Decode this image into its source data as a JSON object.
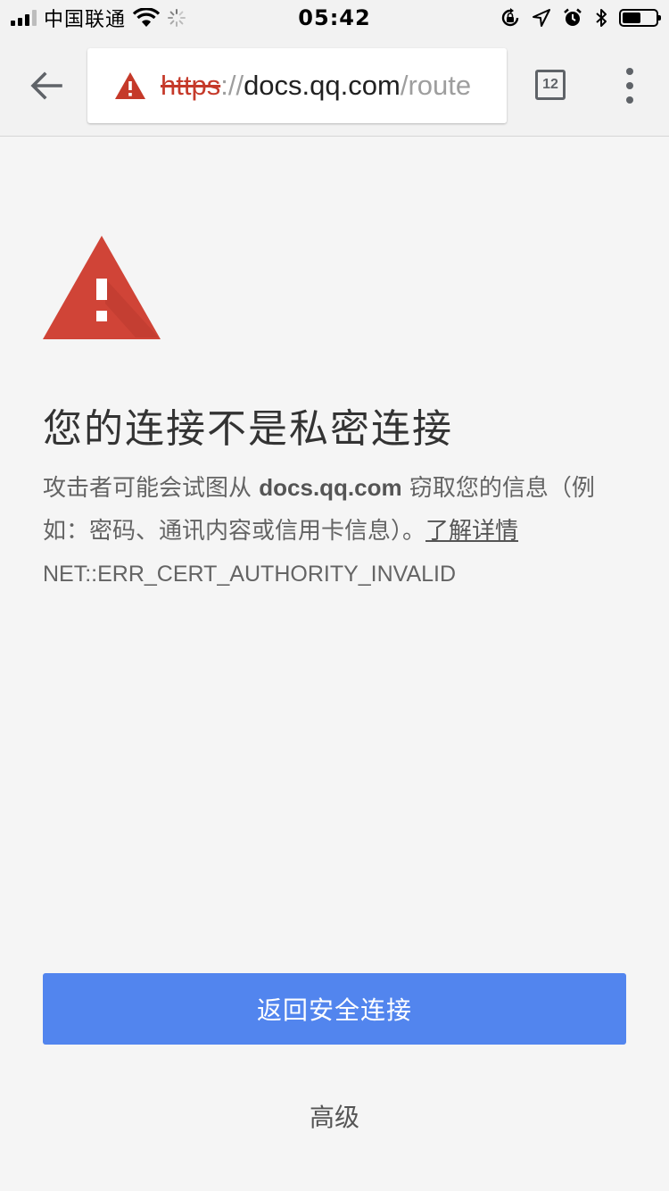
{
  "status_bar": {
    "carrier": "中国联通",
    "time": "05:42",
    "battery_level": 0.55
  },
  "toolbar": {
    "url_scheme": "https",
    "url_separator": "://",
    "url_host": "docs.qq.com",
    "url_path": "/route",
    "tab_count": "12"
  },
  "page": {
    "heading": "您的连接不是私密连接",
    "body_prefix": "攻击者可能会试图从 ",
    "body_host": "docs.qq.com",
    "body_suffix": " 窃取您的信息（例如：密码、通讯内容或信用卡信息）。",
    "learn_more": "了解详情",
    "error_code": "NET::ERR_CERT_AUTHORITY_INVALID",
    "primary_button": "返回安全连接",
    "secondary_button": "高级"
  },
  "colors": {
    "warning_red": "#d04437",
    "primary_blue": "#5285ee"
  }
}
